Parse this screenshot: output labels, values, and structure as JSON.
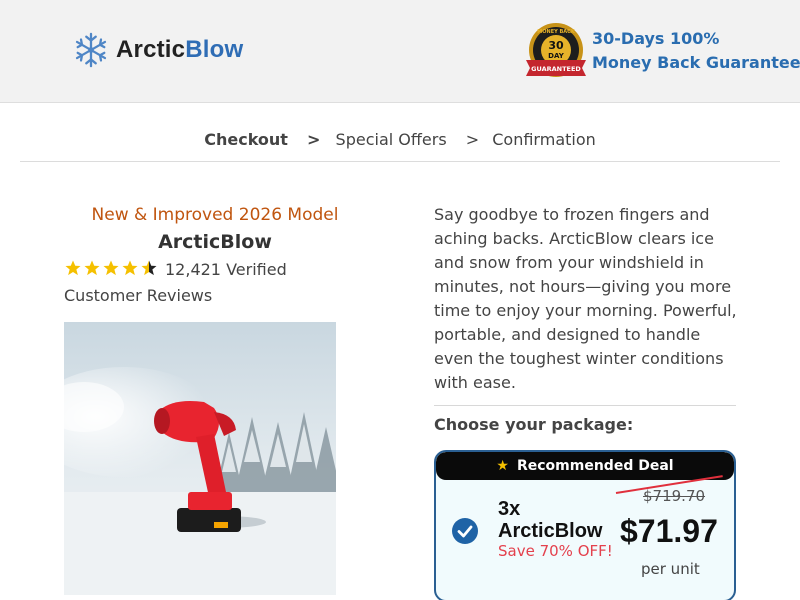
{
  "header": {
    "logo_part1": "Arctic",
    "logo_part2": "Blow",
    "badge_text": "30 DAY MONEY BACK GUARANTEE",
    "guarantee_line1": "30-Days 100%",
    "guarantee_line2": "Money Back Guarantee"
  },
  "breadcrumb": {
    "step1": "Checkout",
    "sep": ">",
    "step2": "Special Offers",
    "step3": "Confirmation"
  },
  "product": {
    "model_tag": "New & Improved 2026 Model",
    "name": "ArcticBlow",
    "rating_value": 4.5,
    "rating_text": "12,421 Verified Customer Reviews"
  },
  "description": "Say goodbye to frozen fingers and aching backs. ArcticBlow clears ice and snow from your windshield in minutes, not hours—giving you more time to enjoy your morning. Powerful, portable, and designed to handle even the toughest winter conditions with ease.",
  "packages": {
    "heading": "Choose your package:",
    "selected": {
      "ribbon": "Recommended Deal",
      "qty_line1": "3x",
      "qty_line2": "ArcticBlow",
      "savings": "Save 70% OFF!",
      "old_price": "$719.70",
      "price": "$71.97",
      "unit": "per unit"
    }
  },
  "colors": {
    "brand_blue": "#2f6db5",
    "accent_orange": "#c0550f",
    "save_red": "#e4414d",
    "star_gold": "#f5c000",
    "card_border": "#2a5f92"
  }
}
